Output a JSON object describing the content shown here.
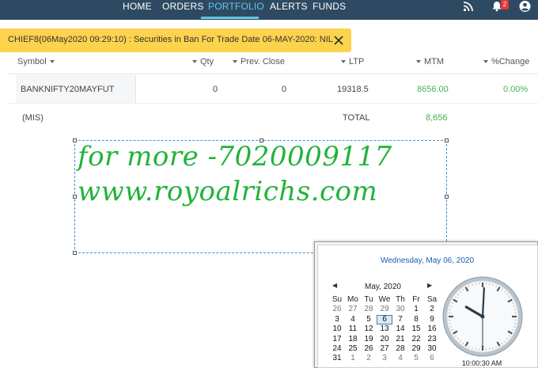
{
  "nav": {
    "items": [
      "HOME",
      "ORDERS",
      "PORTFOLIO",
      "ALERTS",
      "FUNDS"
    ],
    "active": "PORTFOLIO",
    "notification_count": "2",
    "icons": [
      "rss-icon",
      "bell-icon",
      "user-icon"
    ]
  },
  "alert": {
    "text": "CHIEF8(06May2020 09:29:10) : Securities in Ban For Trade Date 06-MAY-2020: NIL"
  },
  "table": {
    "headers": [
      "Symbol",
      "Qty",
      "Prev. Close",
      "LTP",
      "MTM",
      "%Change"
    ],
    "rows": [
      {
        "symbol": "BANKNIFTY20MAYFUT",
        "qty": "0",
        "prev_close": "0",
        "ltp": "19318.5",
        "mtm": "8656.00",
        "change": "0.00%"
      }
    ],
    "footer": {
      "product": "(MIS)",
      "total_label": "TOTAL",
      "total_mtm": "8,656"
    }
  },
  "watermark": {
    "line1": "for more -7020009117",
    "line2": "www.royoalrichs.com"
  },
  "datetime_popup": {
    "long_date": "Wednesday, May 06, 2020",
    "month_label": "May, 2020",
    "weekdays": [
      "Su",
      "Mo",
      "Tu",
      "We",
      "Th",
      "Fr",
      "Sa"
    ],
    "weeks": [
      [
        "26",
        "27",
        "28",
        "29",
        "30",
        "1",
        "2"
      ],
      [
        "3",
        "4",
        "5",
        "6",
        "7",
        "8",
        "9"
      ],
      [
        "10",
        "11",
        "12",
        "13",
        "14",
        "15",
        "16"
      ],
      [
        "17",
        "18",
        "19",
        "20",
        "21",
        "22",
        "23"
      ],
      [
        "24",
        "25",
        "26",
        "27",
        "28",
        "29",
        "30"
      ],
      [
        "31",
        "1",
        "2",
        "3",
        "4",
        "5",
        "6"
      ]
    ],
    "selected_day": "6",
    "time": "10:00:30 AM",
    "clock": {
      "hour": 10,
      "minute": 0,
      "second": 30
    }
  },
  "colors": {
    "nav_bg": "#2e4a62",
    "nav_active": "#5fc9e6",
    "alert_bg": "#fcd34d",
    "positive": "#4caf50",
    "watermark": "#22b33a",
    "calendar_accent": "#1a5fb4"
  }
}
